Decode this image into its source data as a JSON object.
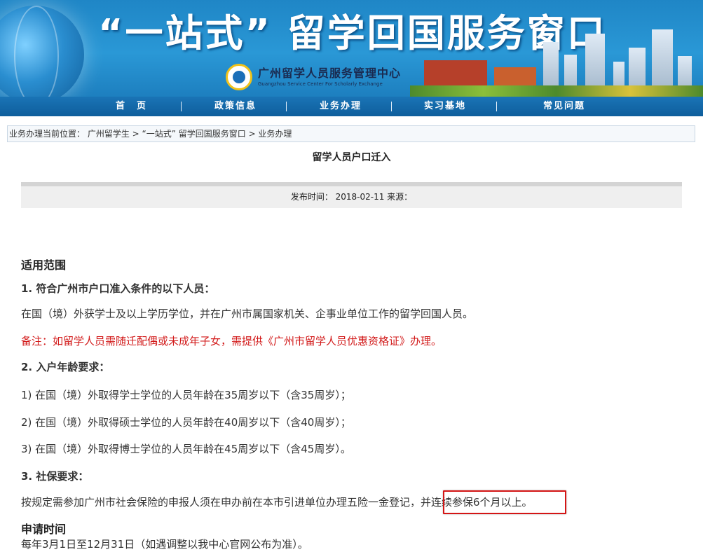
{
  "banner": {
    "title": "“一站式” 留学回国服务窗口",
    "org_name_cn": "广州留学人员服务管理中心",
    "org_name_en": "Guangzhou Service Center For Scholarly Exchange"
  },
  "nav": {
    "items": [
      "首　页",
      "政策信息",
      "业务办理",
      "实习基地",
      "常见问题"
    ]
  },
  "breadcrumb": {
    "text": "业务办理当前位置： 广州留学生 > “一站式” 留学回国服务窗口 > 业务办理"
  },
  "article": {
    "title": "留学人员户口迁入",
    "meta": "发布时间： 2018-02-11 来源："
  },
  "content": {
    "scope_heading": "适用范围",
    "item1_heading": "1. 符合广州市户口准入条件的以下人员：",
    "item1_text": "在国（境）外获学士及以上学历学位，并在广州市属国家机关、企事业单位工作的留学回国人员。",
    "note": "备注：如留学人员需随迁配偶或未成年子女，需提供《广州市留学人员优惠资格证》办理。",
    "item2_heading": "2. 入户年龄要求：",
    "age_rules": [
      "1) 在国（境）外取得学士学位的人员年龄在35周岁以下（含35周岁）；",
      "2) 在国（境）外取得硕士学位的人员年龄在40周岁以下（含40周岁）；",
      "3) 在国（境）外取得博士学位的人员年龄在45周岁以下（含45周岁）。"
    ],
    "item3_heading": "3. 社保要求：",
    "social_text_a": "按规定需参加广州市社会保险的申报人须在申办前在本市引进单位办理五险一金登记，",
    "social_text_b": "并连续参保6个月以上。",
    "apply_heading": "申请时间",
    "apply_text": "每年3月1日至12月31日（如遇调整以我中心官网公布为准）。"
  },
  "colors": {
    "banner": "#2a98d6",
    "navbar": "#1a74b6",
    "note_red": "#d21a1a",
    "highlight_border": "#d41515"
  }
}
